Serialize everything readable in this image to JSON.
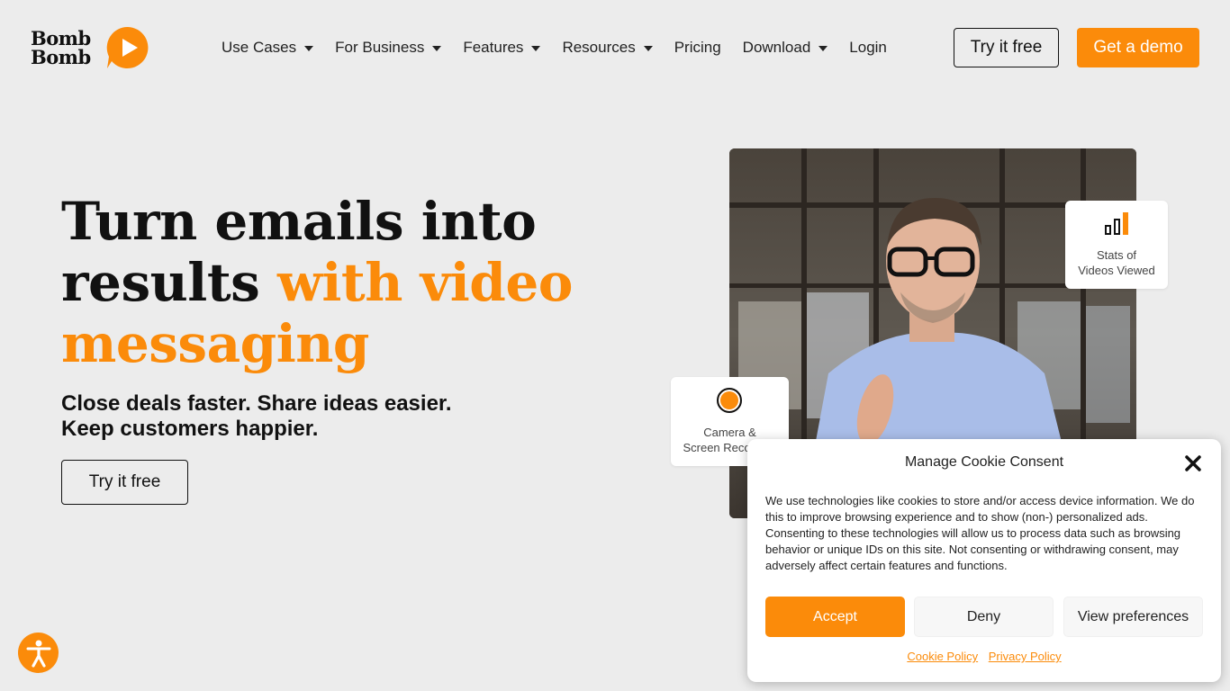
{
  "brand": {
    "logo_line1": "Bomb",
    "logo_line2": "Bomb",
    "accent_color": "#fb8b0a",
    "background_color": "#ececec"
  },
  "nav": {
    "items": [
      {
        "label": "Use Cases",
        "dropdown": true
      },
      {
        "label": "For Business",
        "dropdown": true
      },
      {
        "label": "Features",
        "dropdown": true
      },
      {
        "label": "Resources",
        "dropdown": true
      },
      {
        "label": "Pricing",
        "dropdown": false
      },
      {
        "label": "Download",
        "dropdown": true
      },
      {
        "label": "Login",
        "dropdown": false
      }
    ],
    "try_free_label": "Try it free",
    "demo_label": "Get a demo"
  },
  "hero": {
    "title_part1": "Turn emails into results ",
    "title_accent": "with video messaging",
    "subtitle_line1": "Close deals faster. Share ideas easier.",
    "subtitle_line2": "Keep customers happier.",
    "cta_label": "Try it free"
  },
  "feature_cards": {
    "stats": {
      "icon": "bar-chart-icon",
      "line1": "Stats of",
      "line2": "Videos Viewed"
    },
    "camera": {
      "icon": "record-icon",
      "line1": "Camera &",
      "line2": "Screen Recording"
    }
  },
  "accessibility": {
    "icon": "accessibility-icon"
  },
  "cookie_dialog": {
    "title": "Manage Cookie Consent",
    "body": "We use technologies like cookies to store and/or access device information. We do this to improve browsing experience and to show (non-) personalized ads. Consenting to these technologies will allow us to process data such as browsing behavior or unique IDs on this site. Not consenting or withdrawing consent, may adversely affect certain features and functions.",
    "accept_label": "Accept",
    "deny_label": "Deny",
    "preferences_label": "View preferences",
    "cookie_policy_label": "Cookie Policy",
    "privacy_policy_label": "Privacy Policy"
  }
}
